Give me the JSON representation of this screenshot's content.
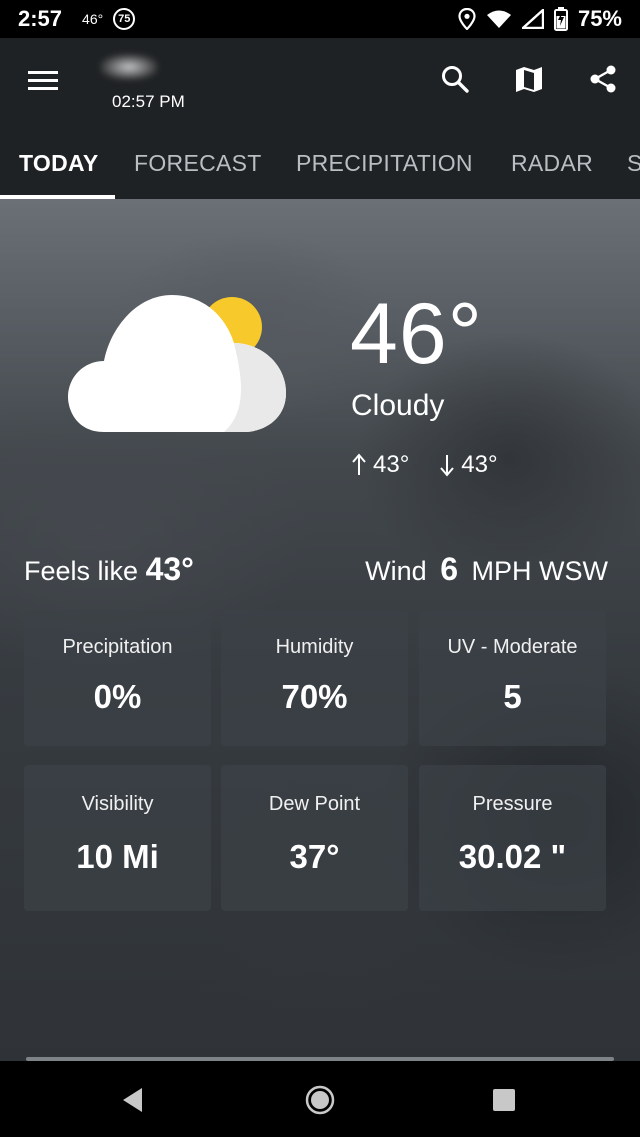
{
  "status_bar": {
    "time": "2:57",
    "temp": "46°",
    "aqi": "75",
    "battery": "75%"
  },
  "app_bar": {
    "time": "02:57 PM",
    "icons": [
      "menu-icon",
      "search-icon",
      "map-icon",
      "share-icon"
    ]
  },
  "tabs": [
    {
      "label": "TODAY",
      "active": true
    },
    {
      "label": "FORECAST",
      "active": false
    },
    {
      "label": "PRECIPITATION",
      "active": false
    },
    {
      "label": "RADAR",
      "active": false
    },
    {
      "label": "S",
      "active": false
    }
  ],
  "current": {
    "temperature": "46°",
    "condition": "Cloudy",
    "high": "43°",
    "low": "43°",
    "icon": "partly-cloudy-icon"
  },
  "feels_like": {
    "label": "Feels like",
    "value": "43°"
  },
  "wind": {
    "label": "Wind",
    "speed": "6",
    "unit_dir": "MPH WSW"
  },
  "tiles": [
    {
      "label": "Precipitation",
      "value": "0%"
    },
    {
      "label": "Humidity",
      "value": "70%"
    },
    {
      "label": "UV - Moderate",
      "value": "5"
    },
    {
      "label": "Visibility",
      "value": "10 Mi"
    },
    {
      "label": "Dew Point",
      "value": "37°"
    },
    {
      "label": "Pressure",
      "value": "30.02 \""
    }
  ],
  "colors": {
    "app_bar": "#1f2224",
    "sun": "#f7c92a",
    "tile_bg": "#3c4146"
  }
}
